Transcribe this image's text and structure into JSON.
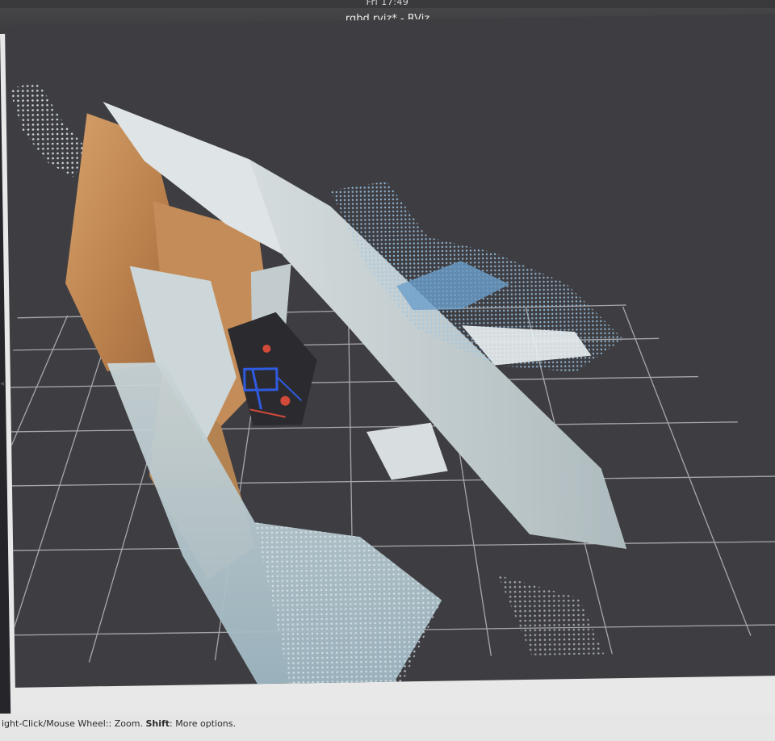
{
  "clock": "Fri 17:49",
  "window": {
    "title": "rgbd.rviz* - RViz"
  },
  "status_bar": {
    "part1": "ight-Click/Mouse Wheel:: Zoom. ",
    "shift_key": "Shift",
    "part2": ": More options."
  },
  "viewport": {
    "background_color": "#3e3e42",
    "grid_color": "#a7a7ab",
    "description_icon": "point-cloud"
  },
  "colors": {
    "wood": "#c48a56",
    "wall": "#c9d2d4",
    "blue_points": "#7fb0d8",
    "robot_blue": "#2f5be0",
    "robot_red": "#d24a3a"
  }
}
